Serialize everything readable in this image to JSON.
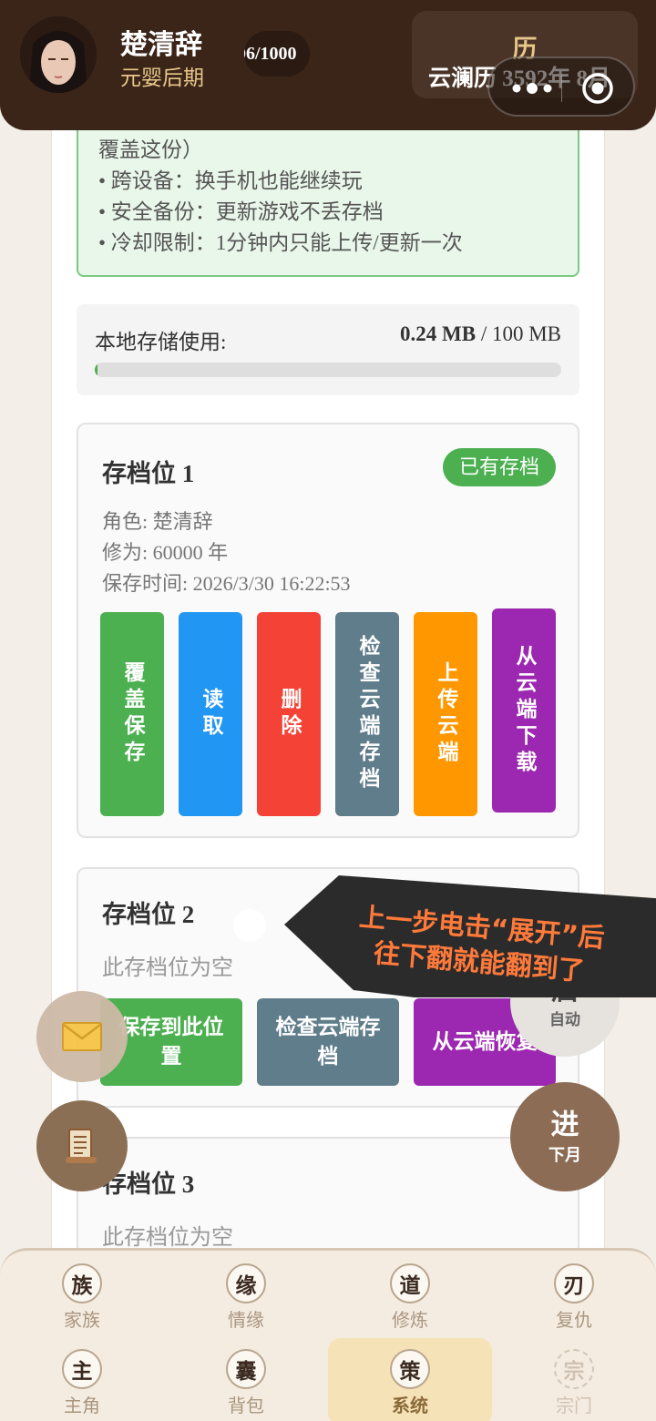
{
  "header": {
    "name": "楚清辞",
    "realm": "元婴后期",
    "progress": "06/1000",
    "calendar_title": "历",
    "calendar_date": "云澜历 3592年 8月"
  },
  "notice": {
    "lines": [
      "覆盖这份）",
      "• 跨设备：换手机也能继续玩",
      "• 安全备份：更新游戏不丢存档",
      "• 冷却限制：1分钟内只能上传/更新一次"
    ]
  },
  "storage": {
    "label": "本地存储使用:",
    "used": "0.24 MB",
    "separator": " / ",
    "total": "100 MB",
    "used_fraction": 0.0024
  },
  "slots": [
    {
      "title": "存档位 1",
      "badge": "已有存档",
      "character": "角色: 楚清辞",
      "cultivation": "修为: 60000 年",
      "saved_at": "保存时间: 2026/3/30 16:22:53",
      "buttons": [
        "覆盖保存",
        "读取",
        "删除",
        "检查云端存档",
        "上传云端",
        "从云端下载"
      ]
    },
    {
      "title": "存档位 2",
      "empty_text": "此存档位为空",
      "buttons": [
        "保存到此位置",
        "检查云端存档",
        "从云端恢复"
      ]
    },
    {
      "title": "存档位 3",
      "empty_text": "此存档位为空"
    }
  ],
  "tooltip": {
    "line1": "上一步电击“展开”后",
    "line2": "往下翻就能翻到了"
  },
  "floating": {
    "start_big": "启",
    "start_small": "自动",
    "next_big": "进",
    "next_small": "下月"
  },
  "nav": {
    "row1": [
      {
        "icon": "族",
        "label": "家族"
      },
      {
        "icon": "缘",
        "label": "情缘"
      },
      {
        "icon": "道",
        "label": "修炼"
      },
      {
        "icon": "刃",
        "label": "复仇"
      }
    ],
    "row2": [
      {
        "icon": "主",
        "label": "主角"
      },
      {
        "icon": "囊",
        "label": "背包"
      },
      {
        "icon": "策",
        "label": "系统"
      },
      {
        "icon": "宗",
        "label": "宗门"
      }
    ]
  },
  "colors": {
    "header_bg": "#3b2519",
    "accent_gold": "#e8c88a",
    "green": "#4caf50",
    "blue": "#2196f3",
    "red": "#f44336",
    "slate": "#607d8b",
    "orange": "#ff9800",
    "purple": "#9c27b0",
    "tooltip_text": "#ff7a3a"
  },
  "icons": [
    "avatar-portrait",
    "more-dots-icon",
    "target-icon",
    "mail-icon",
    "scroll-icon"
  ]
}
